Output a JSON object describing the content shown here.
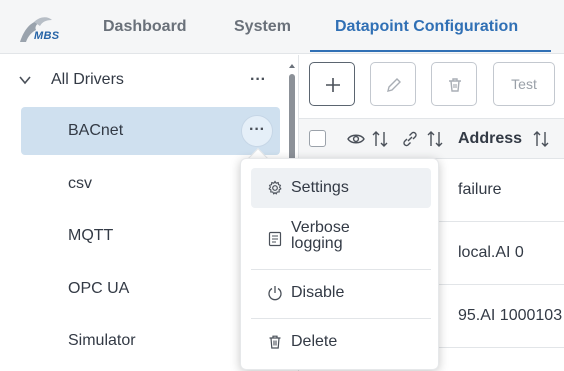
{
  "header": {
    "logo_text": "MBS",
    "tabs": [
      {
        "label": "Dashboard"
      },
      {
        "label": "System"
      },
      {
        "label": "Datapoint Configuration"
      }
    ],
    "active_tab": "Datapoint Configuration"
  },
  "tree": {
    "root_label": "All Drivers",
    "root_menu": "···",
    "items": [
      {
        "label": "BACnet",
        "selected": true
      },
      {
        "label": "csv"
      },
      {
        "label": "MQTT"
      },
      {
        "label": "OPC UA"
      },
      {
        "label": "Simulator"
      }
    ],
    "item_menu": "···"
  },
  "toolbar": {
    "add_icon": "plus-icon",
    "edit_icon": "pencil-icon",
    "delete_icon": "trash-icon",
    "test_label": "Test"
  },
  "table": {
    "columns": [
      {
        "icon": "eye-icon",
        "sort_icon": "sort-icon"
      },
      {
        "icon": "link-icon",
        "sort_icon": "sort-icon"
      },
      {
        "label": "Address",
        "sort_icon": "sort-icon"
      }
    ],
    "rows": [
      {
        "address": "failure"
      },
      {
        "address": "local.AI 0"
      },
      {
        "address": "95.AI 1000103"
      }
    ]
  },
  "context_menu": {
    "items": [
      {
        "label": "Settings",
        "icon": "gear-icon"
      },
      {
        "label": "Verbose logging",
        "line1": "Verbose",
        "line2": "logging",
        "icon": "document-icon"
      },
      {
        "label": "Disable",
        "icon": "power-icon"
      },
      {
        "label": "Delete",
        "icon": "trash-icon"
      }
    ]
  },
  "colors": {
    "accent": "#3070b5",
    "selected_bg": "#cfe0ef",
    "header_bg": "#f5f6f7"
  }
}
